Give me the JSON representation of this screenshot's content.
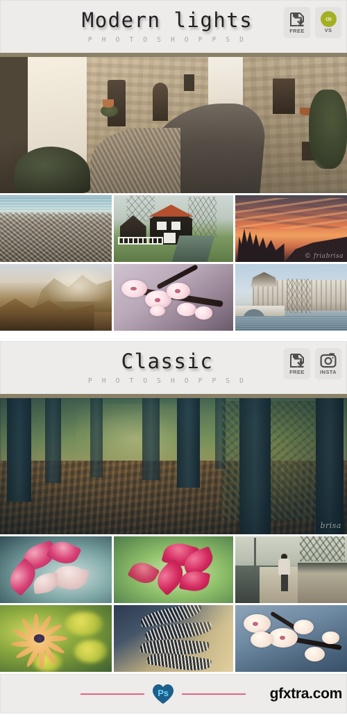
{
  "page": {
    "background": "#ffffff",
    "header_background": "#edecea",
    "divider_color": "#8a8168",
    "accent_pink": "#e8617f",
    "badge_green": "#a3b023",
    "heart_blue": "#1b5f8c"
  },
  "sections": [
    {
      "id": "modern-lights",
      "title": "Modern lights",
      "subtitle": "P H O T O S H O P   P S D",
      "badges": [
        {
          "name": "free-badge",
          "icon": "floppy-download-icon",
          "label": "FREE"
        },
        {
          "name": "creativemarket-badge",
          "icon": "creative-market-circle-icon",
          "glyph_text": "co",
          "label": "VS"
        }
      ],
      "hero": {
        "name": "hero-village-alley",
        "caption": "Warm-toned stone village alley with cobblestone road",
        "watermark": ""
      },
      "thumbnails": [
        {
          "name": "thumb-pebble-beach",
          "caption": "Pebble beach and sea",
          "watermark": ""
        },
        {
          "name": "thumb-dutch-house",
          "caption": "Dutch house beside canal",
          "watermark": ""
        },
        {
          "name": "thumb-orange-sunset",
          "caption": "Orange sunset over treeline",
          "watermark": "© friabrisa"
        },
        {
          "name": "thumb-golden-mountains",
          "caption": "Golden sunlit mountain range",
          "watermark": ""
        },
        {
          "name": "thumb-cherry-blossom",
          "caption": "Pink cherry blossom branch",
          "watermark": ""
        },
        {
          "name": "thumb-louvre-paris",
          "caption": "Louvre palace on the Seine",
          "watermark": ""
        }
      ]
    },
    {
      "id": "classic",
      "title": "Classic",
      "subtitle": "P H O T O S H O P   P S D",
      "badges": [
        {
          "name": "free-badge",
          "icon": "floppy-download-icon",
          "label": "FREE"
        },
        {
          "name": "instagram-badge",
          "icon": "instagram-camera-icon",
          "label": "INSTA"
        }
      ],
      "hero": {
        "name": "hero-autumn-forest",
        "caption": "Teal-toned autumn forest with fallen leaves",
        "watermark": "brisa"
      },
      "thumbnails": [
        {
          "name": "thumb-pink-leaves",
          "caption": "Magenta leaves on teal background",
          "watermark": ""
        },
        {
          "name": "thumb-red-leaves",
          "caption": "Red leaves on green background",
          "watermark": ""
        },
        {
          "name": "thumb-walking-person",
          "caption": "Person walking along a sidewalk",
          "watermark": ""
        },
        {
          "name": "thumb-yellow-daisy",
          "caption": "Orange daisy in yellow field",
          "watermark": ""
        },
        {
          "name": "thumb-feathers",
          "caption": "Striped black and white feathers",
          "watermark": ""
        },
        {
          "name": "thumb-blue-blossom",
          "caption": "Cherry blossoms on blue sky",
          "watermark": ""
        }
      ]
    }
  ],
  "footer": {
    "heart_label": "Ps",
    "watermark": "gfxtra.com"
  }
}
